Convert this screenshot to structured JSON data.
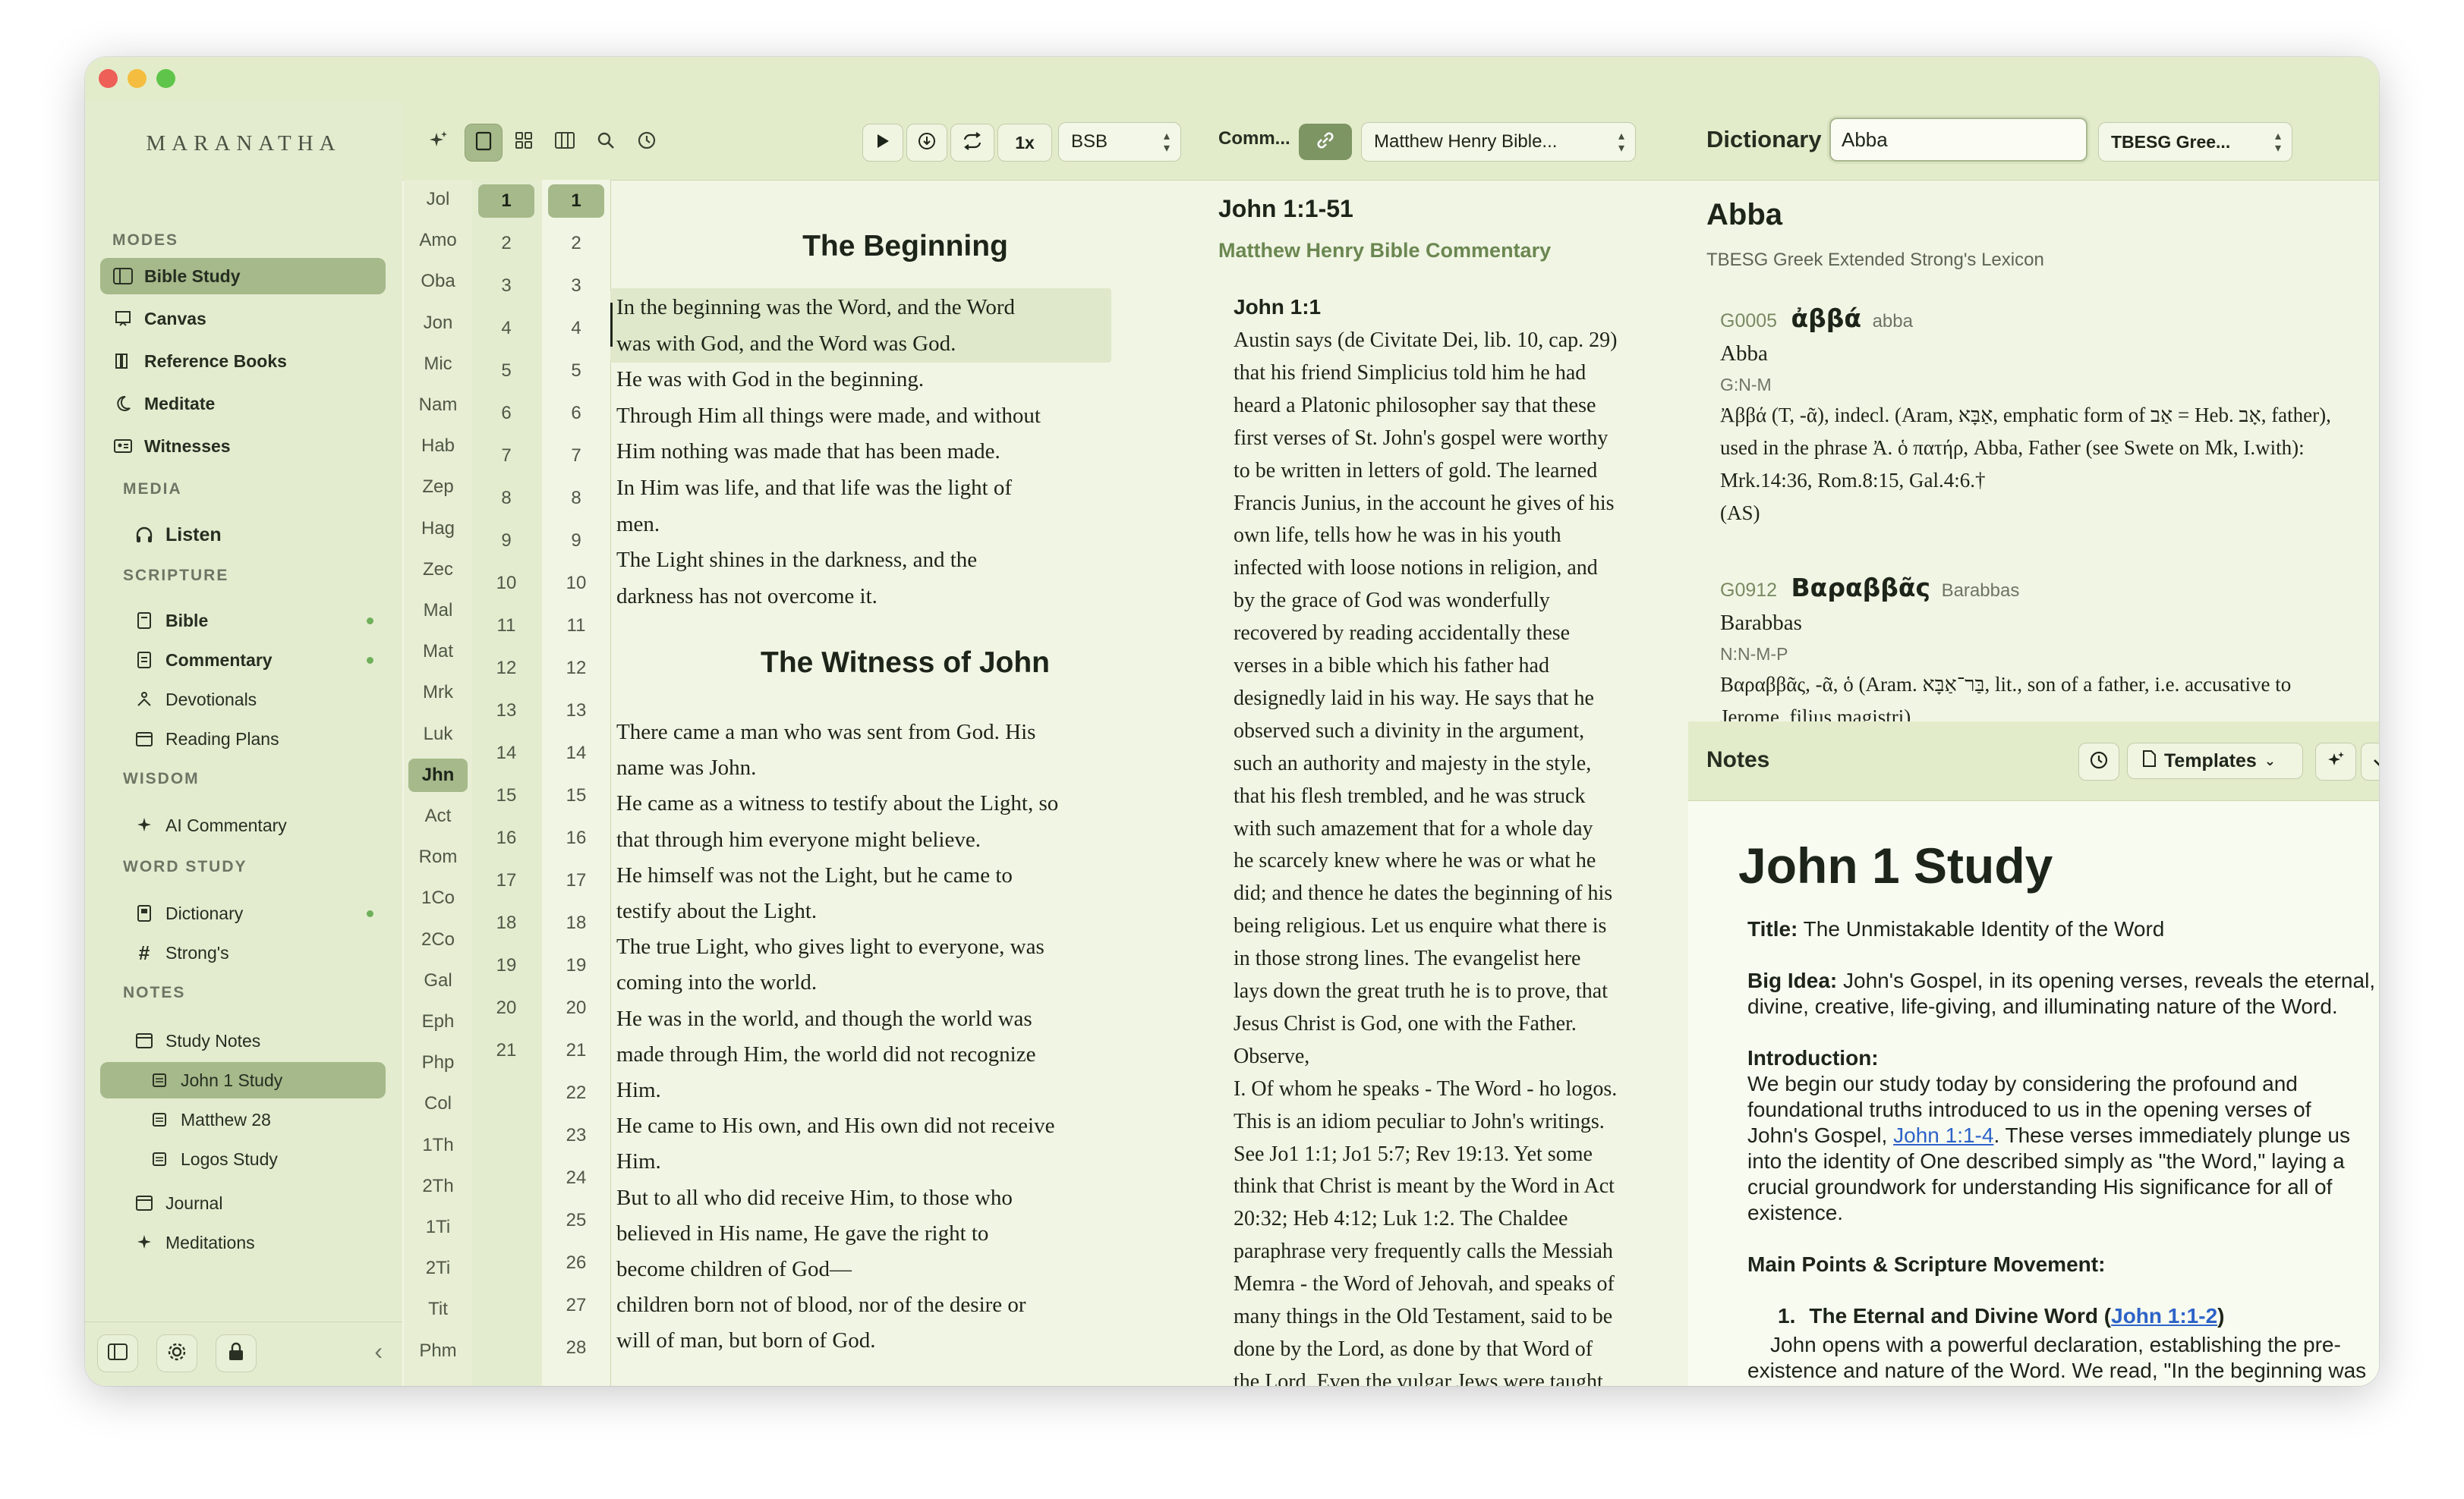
{
  "app": {
    "brand": "MARANATHA"
  },
  "sidebar": {
    "sections": {
      "modes": "MODES",
      "media": "MEDIA",
      "scripture": "SCRIPTURE",
      "wisdom": "WISDOM",
      "word_study": "WORD STUDY",
      "notes": "NOTES"
    },
    "modes": [
      {
        "label": "Bible Study",
        "icon": "columns-icon",
        "selected": true
      },
      {
        "label": "Canvas",
        "icon": "canvas-icon"
      },
      {
        "label": "Reference Books",
        "icon": "books-icon"
      },
      {
        "label": "Meditate",
        "icon": "moon-icon"
      },
      {
        "label": "Witnesses",
        "icon": "id-card-icon"
      }
    ],
    "media": [
      {
        "label": "Listen",
        "icon": "headphones-icon"
      }
    ],
    "scripture": [
      {
        "label": "Bible",
        "icon": "book-icon",
        "dot": true
      },
      {
        "label": "Commentary",
        "icon": "commentary-icon",
        "dot": true
      },
      {
        "label": "Devotionals",
        "icon": "devotional-icon"
      },
      {
        "label": "Reading Plans",
        "icon": "calendar-icon"
      }
    ],
    "wisdom": [
      {
        "label": "AI Commentary",
        "icon": "sparkle-icon"
      }
    ],
    "word_study": [
      {
        "label": "Dictionary",
        "icon": "dictionary-icon",
        "dot": true
      },
      {
        "label": "Strong's",
        "icon": "hash-icon"
      }
    ],
    "notes": [
      {
        "label": "Study Notes",
        "icon": "notes-folder-icon"
      },
      {
        "label": "John 1 Study",
        "icon": "note-icon",
        "selected": true
      },
      {
        "label": "Matthew 28",
        "icon": "note-icon"
      },
      {
        "label": "Logos Study",
        "icon": "note-icon"
      },
      {
        "label": "Journal",
        "icon": "journal-icon"
      },
      {
        "label": "Meditations",
        "icon": "sparkle-icon"
      }
    ]
  },
  "bible": {
    "playback_speed": "1x",
    "translation": "BSB",
    "books": [
      "Jol",
      "Amo",
      "Oba",
      "Jon",
      "Mic",
      "Nam",
      "Hab",
      "Zep",
      "Hag",
      "Zec",
      "Mal",
      "Mat",
      "Mrk",
      "Luk",
      "Jhn",
      "Act",
      "Rom",
      "1Co",
      "2Co",
      "Gal",
      "Eph",
      "Php",
      "Col",
      "1Th",
      "2Th",
      "1Ti",
      "2Ti",
      "Tit",
      "Phm"
    ],
    "selected_book": "Jhn",
    "chapters": [
      "1",
      "2",
      "3",
      "4",
      "5",
      "6",
      "7",
      "8",
      "9",
      "10",
      "11",
      "12",
      "13",
      "14",
      "15",
      "16",
      "17",
      "18",
      "19",
      "20",
      "21"
    ],
    "selected_chapter": "1",
    "verses": [
      "1",
      "2",
      "3",
      "4",
      "5",
      "6",
      "7",
      "8",
      "9",
      "10",
      "11",
      "12",
      "13",
      "14",
      "15",
      "16",
      "17",
      "18",
      "19",
      "20",
      "21",
      "22",
      "23",
      "24",
      "25",
      "26",
      "27",
      "28"
    ],
    "selected_verse": "1",
    "heading1": "The Beginning",
    "heading2": "The Witness of John",
    "lines": [
      "In the beginning was the Word, and the Word",
      "was with God, and the Word was God.",
      "He was with God in the beginning.",
      "Through Him all things were made, and without",
      "Him nothing was made that has been made.",
      "In Him was life, and that life was the light of",
      "men.",
      "The Light shines in the darkness, and the",
      "darkness has not overcome it.",
      "There came a man who was sent from God. His",
      "name was John.",
      "He came as a witness to testify about the Light, so",
      "that through him everyone might believe.",
      "He himself was not the Light, but he came to",
      "testify about the Light.",
      "The true Light, who gives light to everyone, was",
      "coming into the world.",
      "He was in the world, and though the world was",
      "made through Him, the world did not recognize",
      "Him.",
      "He came to His own, and His own did not receive",
      "Him.",
      "But to all who did receive Him, to those who",
      "believed in His name, He gave the right to",
      "become children of God—",
      "children born not of blood, nor of the desire or",
      "will of man, but born of God."
    ]
  },
  "commentary": {
    "label": "Comm...",
    "source": "Matthew Henry Bible...",
    "range": "John 1:1-51",
    "title": "Matthew Henry Bible Commentary",
    "verse_head": "John 1:1",
    "lines": [
      "Austin says (de Civitate Dei, lib. 10, cap. 29)",
      "that his friend Simplicius told him he had",
      "heard a Platonic philosopher say that these",
      "first verses of St. John's gospel were worthy",
      "to be written in letters of gold. The learned",
      "Francis Junius, in the account he gives of his",
      "own life, tells how he was in his youth",
      "infected with loose notions in religion, and",
      "by the grace of God was wonderfully",
      "recovered by reading accidentally these",
      "verses in a bible which his father had",
      "designedly laid in his way. He says that he",
      "observed such a divinity in the argument,",
      "such an authority and majesty in the style,",
      "that his flesh trembled, and he was struck",
      "with such amazement that for a whole day",
      "he scarcely knew where he was or what he",
      "did; and thence he dates the beginning of his",
      "being religious. Let us enquire what there is",
      "in those strong lines. The evangelist here",
      "lays down the great truth he is to prove, that",
      "Jesus Christ is God, one with the Father.",
      "Observe,",
      "I. Of whom he speaks - The Word - ho logos.",
      "This is an idiom peculiar to John's writings.",
      "See Jo1 1:1; Jo1 5:7; Rev 19:13. Yet some",
      "think that Christ is meant by the Word in Act",
      "20:32; Heb 4:12; Luk 1:2. The Chaldee",
      "paraphrase very frequently calls the Messiah",
      "Memra - the Word of Jehovah, and speaks of",
      "many things in the Old Testament, said to be",
      "done by the Lord, as done by that Word of",
      "the Lord. Even the vulgar Jews were taught"
    ]
  },
  "dictionary": {
    "label": "Dictionary",
    "query": "Abba",
    "lexicon_short": "TBESG Gree...",
    "headword": "Abba",
    "lexicon": "TBESG Greek Extended Strong's Lexicon",
    "entries": [
      {
        "strong": "G0005",
        "greek": "ἀββά",
        "translit": "abba",
        "gloss": "Abba",
        "morph": "G:N-M",
        "def": [
          "Ἀββά (T, -ᾶ), indecl. (Aram, אַבָּא, emphatic form of אַב = Heb. אָב, father),",
          " used in the phrase Ἀ. ὁ πατήρ, Abba, Father (see Swete on Mk, I.with):",
          "Mrk.14:36, Rom.8:15, Gal.4:6.†",
          " (AS)"
        ]
      },
      {
        "strong": "G0912",
        "greek": "Βαραββᾶς",
        "translit": "Barabbas",
        "gloss": "Barabbas",
        "morph": "N:N-M-P",
        "def": [
          "Βαραββᾶς, -ᾶ, ὁ (Aram. בַּר־אַבָּא, lit., son of a father, i.e. accusative to",
          "Jerome, filius magistri)"
        ]
      }
    ]
  },
  "notes": {
    "label": "Notes",
    "templates": "Templates",
    "title": "John 1 Study",
    "title_label": "Title:",
    "title_text": " The Unmistakable Identity of the Word",
    "bigidea_label": "Big Idea:",
    "bigidea_1": " John's Gospel, in its opening verses, reveals the eternal,",
    "bigidea_2": "divine, creative, life-giving, and illuminating nature of the Word.",
    "intro_label": "Introduction:",
    "intro_1": "We begin our study today by considering the profound and",
    "intro_2": "foundational truths introduced to us in the opening verses of",
    "intro_3a": "John's Gospel, ",
    "intro_link": "John 1:1-4",
    "intro_3b": ". These verses immediately plunge us",
    "intro_4": "into the identity of One described simply as \"the Word,\" laying a",
    "intro_5": "crucial groundwork for understanding His significance for all of",
    "intro_6": "existence.",
    "main_label": "Main Points & Scripture Movement:",
    "point1_num": "1.",
    "point1_text": "The Eternal and Divine Word (",
    "point1_link": "John 1:1-2",
    "point1_close": ")",
    "point1_body1": "John opens with a powerful declaration, establishing the pre-",
    "point1_body2": "existence and nature of the Word. We read, \"In the beginning was"
  },
  "colors": {
    "accent": "#a6b98a",
    "sidebar": "#e4ecd0",
    "toolbar": "#e3ecca",
    "link": "#2d63c8"
  }
}
